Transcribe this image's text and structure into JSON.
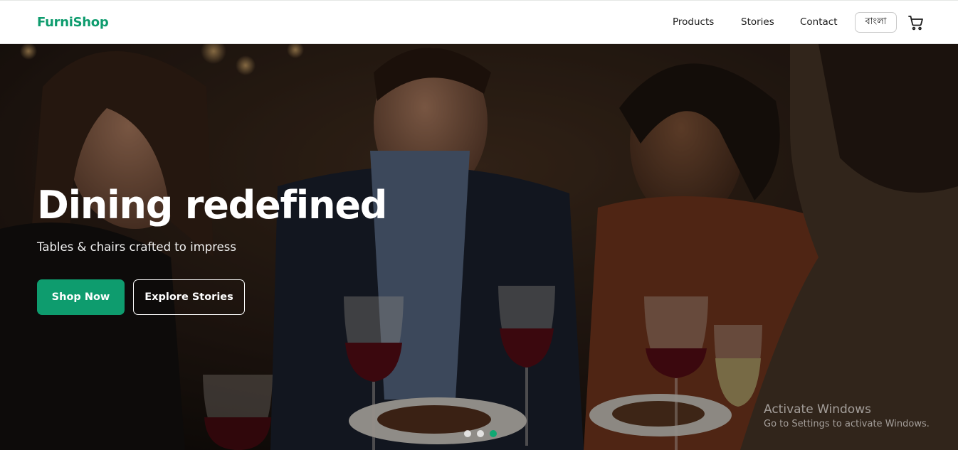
{
  "brand": {
    "name": "FurniShop",
    "accent_color": "#0e9c6e"
  },
  "nav": {
    "links": [
      "Products",
      "Stories",
      "Contact"
    ],
    "language_label": "বাংলা",
    "cart_icon": "shopping-cart-icon"
  },
  "hero": {
    "title": "Dining redefined",
    "subtitle": "Tables & chairs crafted to impress",
    "primary_button": "Shop Now",
    "secondary_button": "Explore Stories",
    "image_subject": "friends-dining-with-wine",
    "carousel": {
      "slide_count": 3,
      "active_slide": 3
    }
  },
  "os_watermark": {
    "title": "Activate Windows",
    "subtitle": "Go to Settings to activate Windows."
  }
}
